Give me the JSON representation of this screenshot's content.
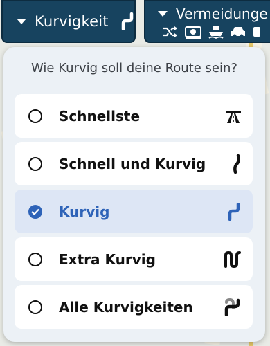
{
  "toolbar": {
    "curviness_button_label": "Kurvigkeit",
    "avoidances_button_label": "Vermeidunge",
    "avoid_icons": [
      "shuffle-icon",
      "toll-icon",
      "ferry-icon",
      "car-icon",
      "more-icon"
    ]
  },
  "panel": {
    "title": "Wie Kurvig soll deine Route sein?",
    "options": [
      {
        "label": "Schnellste",
        "icon": "highway-icon",
        "selected": false
      },
      {
        "label": "Schnell und Kurvig",
        "icon": "slight-curve-icon",
        "selected": false
      },
      {
        "label": "Kurvig",
        "icon": "curve-icon",
        "selected": true
      },
      {
        "label": "Extra Kurvig",
        "icon": "extra-curve-icon",
        "selected": false
      },
      {
        "label": "Alle Kurvigkeiten",
        "icon": "all-curves-icon",
        "selected": false
      }
    ]
  },
  "colors": {
    "toolbar_bg": "#17435f",
    "accent": "#2e63b8",
    "panel_bg": "#ecf1f6",
    "selected_bg": "#dde6f5"
  }
}
